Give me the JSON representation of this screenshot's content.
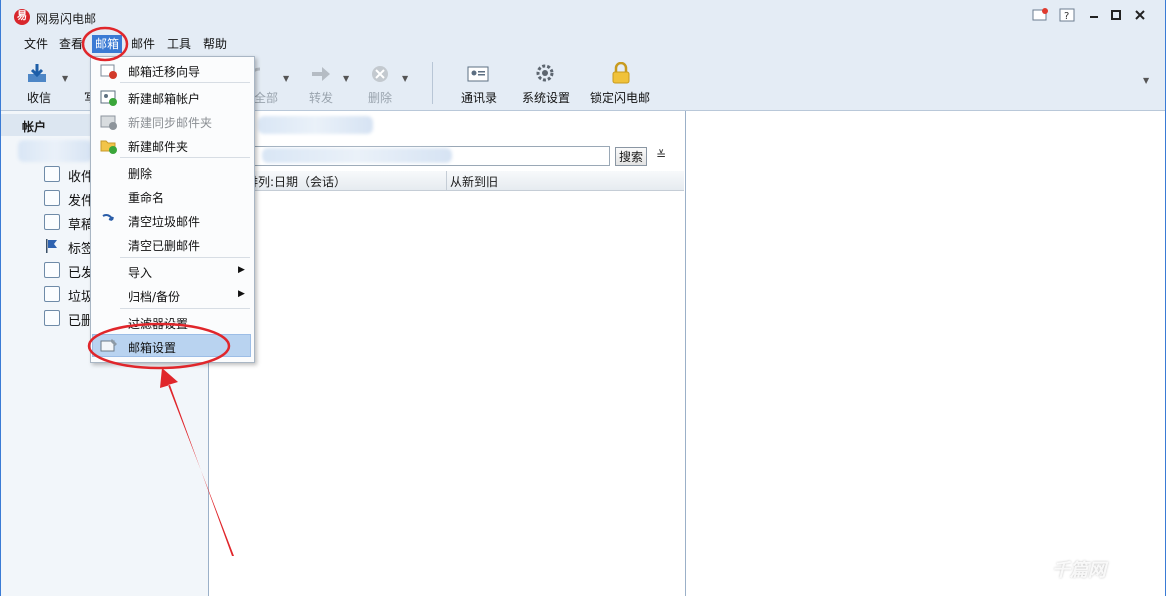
{
  "window": {
    "title": "网易闪电邮",
    "logo_glyph": "易"
  },
  "menubar": {
    "items": [
      "文件",
      "查看",
      "邮箱",
      "邮件",
      "工具",
      "帮助"
    ],
    "active": "邮箱"
  },
  "toolbar": {
    "receive": "收信",
    "write_partial": "写",
    "reply_all": "全部",
    "forward": "转发",
    "delete": "删除",
    "contacts": "通讯录",
    "settings": "系统设置",
    "lock": "锁定闪电邮"
  },
  "sidebar": {
    "header": "帐户",
    "folders": [
      {
        "label": "收件",
        "icon": "inbox-icon"
      },
      {
        "label": "发件",
        "icon": "outbox-icon"
      },
      {
        "label": "草稿",
        "icon": "drafts-icon"
      },
      {
        "label": "标签",
        "icon": "flag-icon"
      },
      {
        "label": "已发",
        "icon": "sent-icon"
      },
      {
        "label": "垃圾",
        "icon": "junk-icon"
      },
      {
        "label": "已删",
        "icon": "trash-icon"
      }
    ]
  },
  "list": {
    "search_button": "搜索",
    "sort_label": "排列:日期（会话）",
    "order_label": "从新到旧"
  },
  "dropdown": {
    "items": [
      {
        "label": "邮箱迁移向导",
        "icon": "migrate-icon",
        "disabled": false
      },
      {
        "label": "新建邮箱帐户",
        "icon": "new-account-icon",
        "disabled": false
      },
      {
        "label": "新建同步邮件夹",
        "icon": "new-sync-folder-icon",
        "disabled": true
      },
      {
        "label": "新建邮件夹",
        "icon": "new-folder-icon",
        "disabled": false
      },
      {
        "label": "删除",
        "icon": "",
        "disabled": false
      },
      {
        "label": "重命名",
        "icon": "",
        "disabled": false
      },
      {
        "label": "清空垃圾邮件",
        "icon": "empty-junk-icon",
        "disabled": false
      },
      {
        "label": "清空已删邮件",
        "icon": "",
        "disabled": false
      },
      {
        "label": "导入",
        "icon": "",
        "disabled": false,
        "submenu": true
      },
      {
        "label": "归档/备份",
        "icon": "",
        "disabled": false,
        "submenu": true
      },
      {
        "label": "过滤器设置",
        "icon": "",
        "disabled": false
      },
      {
        "label": "邮箱设置",
        "icon": "mailbox-settings-icon",
        "disabled": false,
        "highlighted": true
      }
    ]
  },
  "watermark": "千篇网",
  "colors": {
    "accent": "#3a7ad4",
    "annotation": "#e0262b",
    "highlight": "#b9d3f0"
  }
}
